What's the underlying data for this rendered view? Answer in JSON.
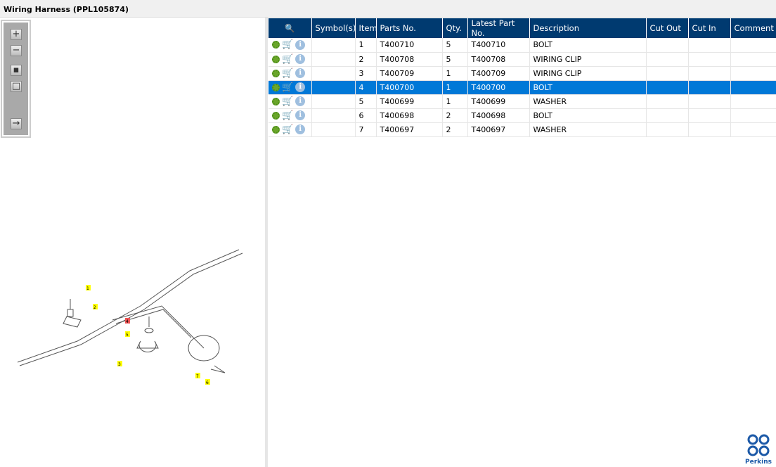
{
  "title": "Wiring Harness (PPL105874)",
  "toolbar": [
    "zoom-in",
    "zoom-out",
    "fit-all",
    "fit-window",
    "toggle-panel"
  ],
  "table": {
    "headers": [
      "Symbol(s)",
      "Item",
      "Parts No.",
      "Qty.",
      "Latest Part No.",
      "Description",
      "Cut Out",
      "Cut In",
      "Comment"
    ],
    "rows": [
      {
        "item": "1",
        "part": "T400710",
        "qty": "5",
        "latest": "T400710",
        "desc": "BOLT"
      },
      {
        "item": "2",
        "part": "T400708",
        "qty": "5",
        "latest": "T400708",
        "desc": "WIRING CLIP"
      },
      {
        "item": "3",
        "part": "T400709",
        "qty": "1",
        "latest": "T400709",
        "desc": "WIRING CLIP"
      },
      {
        "item": "4",
        "part": "T400700",
        "qty": "1",
        "latest": "T400700",
        "desc": "BOLT"
      },
      {
        "item": "5",
        "part": "T400699",
        "qty": "1",
        "latest": "T400699",
        "desc": "WASHER"
      },
      {
        "item": "6",
        "part": "T400698",
        "qty": "2",
        "latest": "T400698",
        "desc": "BOLT"
      },
      {
        "item": "7",
        "part": "T400697",
        "qty": "2",
        "latest": "T400697",
        "desc": "WASHER"
      }
    ],
    "selected_index": 3
  },
  "diagram": {
    "callouts": [
      "1",
      "2",
      "4",
      "5",
      "3",
      "7",
      "6"
    ],
    "highlighted": "4"
  },
  "logo": "Perkins",
  "colors": {
    "header": "#003a70",
    "selected": "#0078d7"
  }
}
